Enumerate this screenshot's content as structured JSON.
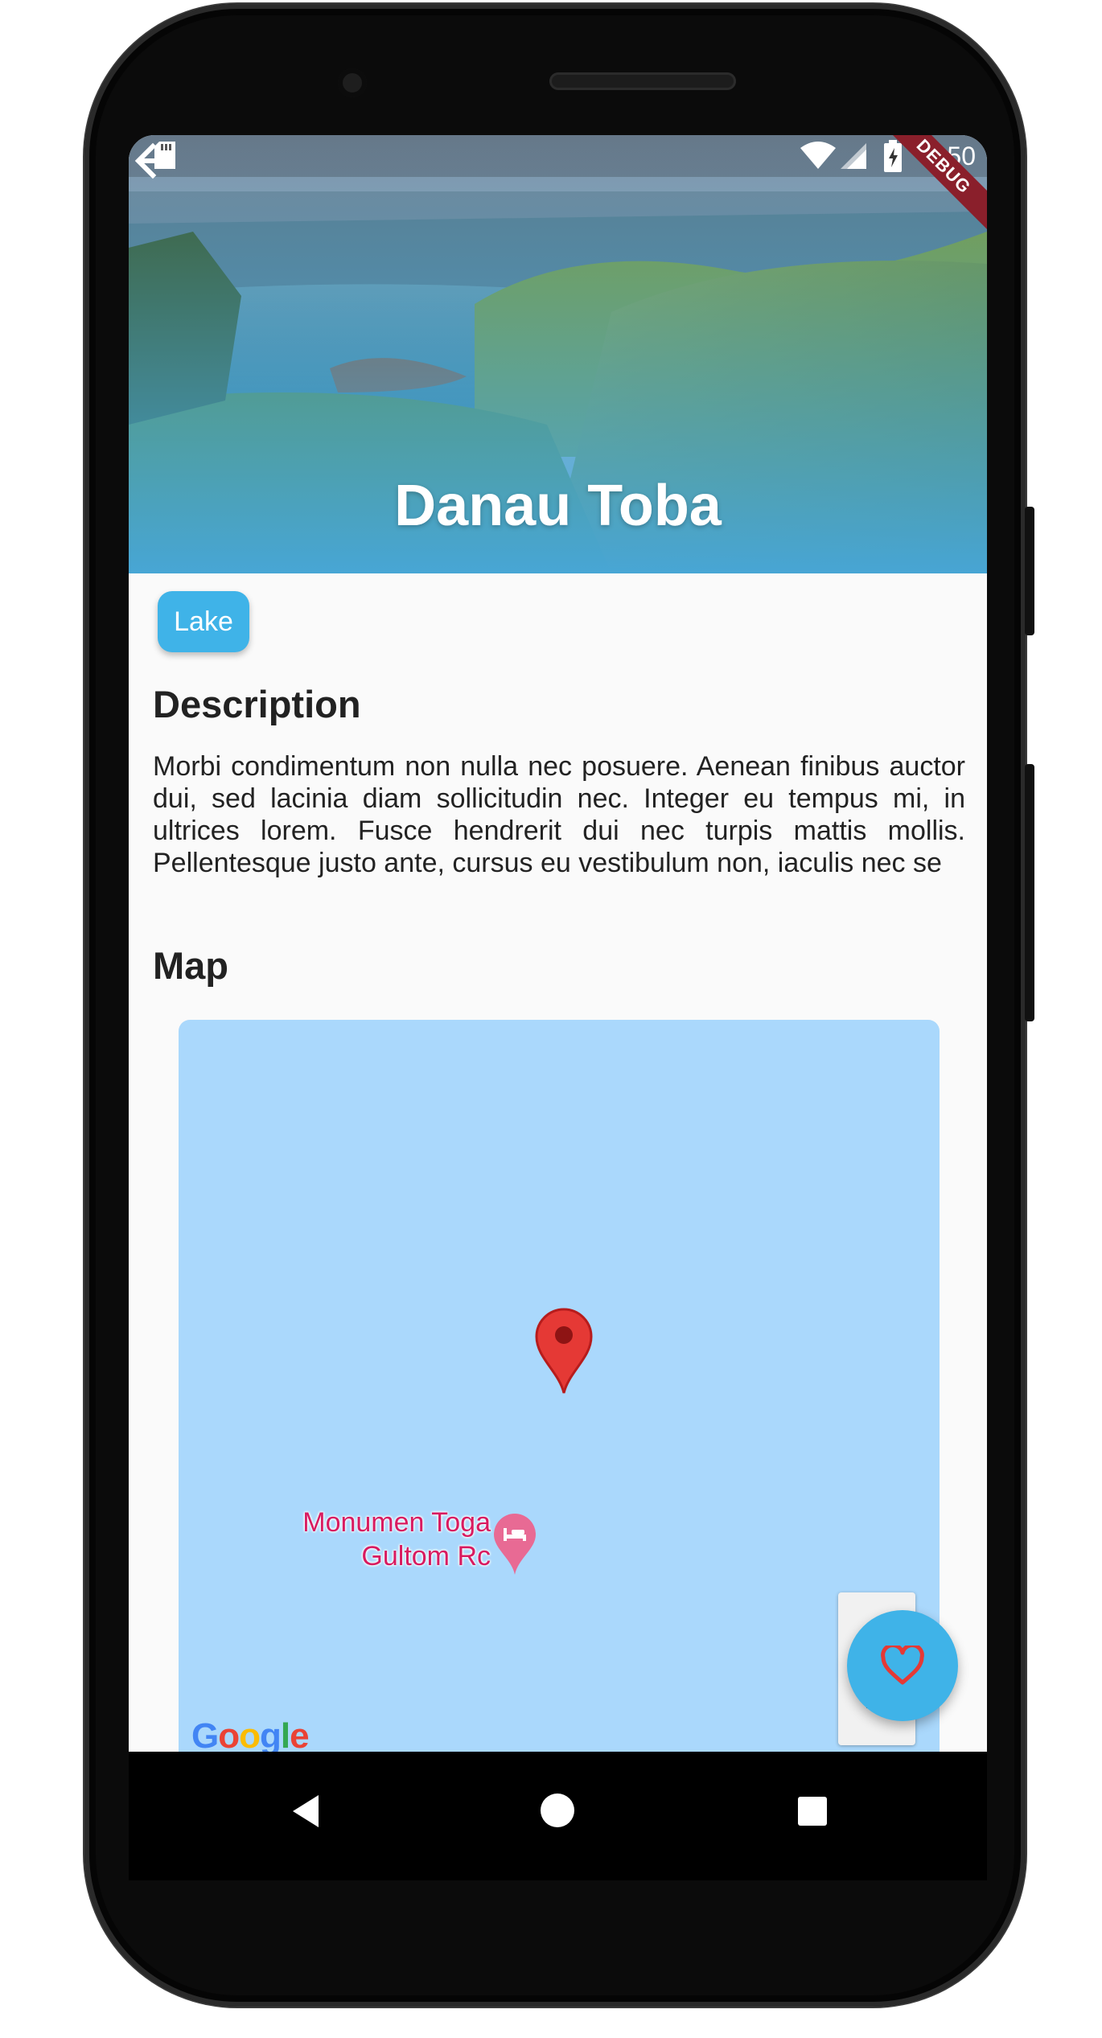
{
  "status_bar": {
    "time": "3:50",
    "debug_banner": "DEBUG"
  },
  "hero": {
    "title": "Danau Toba"
  },
  "category_chip": {
    "label": "Lake"
  },
  "description": {
    "heading": "Description",
    "text": "Morbi condimentum non nulla nec posuere. Aenean finibus auctor dui, sed lacinia diam sollicitudin nec. Integer eu tempus mi, in ultrices lorem. Fusce hendrerit dui nec turpis mattis mollis. Pellentesque justo ante, cursus eu vestibulum non, iaculis nec se"
  },
  "map": {
    "heading": "Map",
    "place_label_line1": "Monumen Toga",
    "place_label_line2": "Gultom Rc",
    "zoom_in": "+",
    "zoom_out": "−",
    "attribution": "Google"
  },
  "colors": {
    "accent": "#3fb3e8",
    "map_water": "#aad8fc",
    "pin_red": "#e53935",
    "place_pink": "#d81b60"
  },
  "icons": {
    "back": "arrow-left-icon",
    "favorite": "heart-outline-icon",
    "nav_back": "triangle-back-icon",
    "nav_home": "circle-home-icon",
    "nav_recents": "square-recents-icon"
  }
}
